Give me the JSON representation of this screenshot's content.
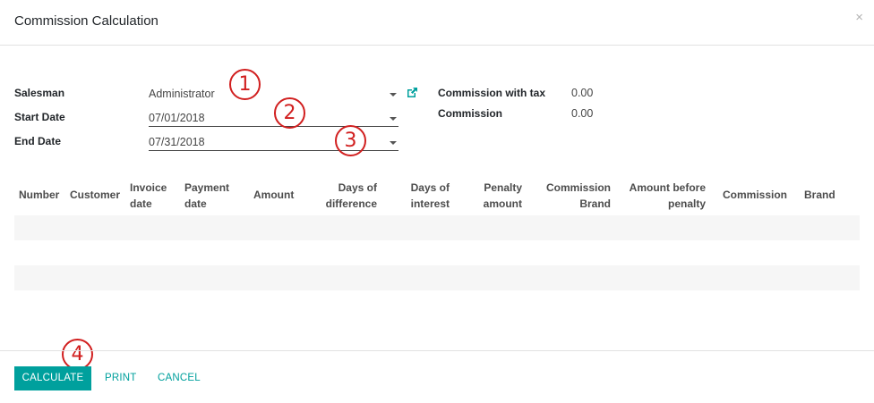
{
  "dialog": {
    "title": "Commission Calculation",
    "close_label": "×"
  },
  "form": {
    "salesman": {
      "label": "Salesman",
      "value": "Administrator"
    },
    "start_date": {
      "label": "Start Date",
      "value": "07/01/2018"
    },
    "end_date": {
      "label": "End Date",
      "value": "07/31/2018"
    }
  },
  "stats": {
    "commission_with_tax": {
      "label": "Commission with tax",
      "value": "0.00"
    },
    "commission": {
      "label": "Commission",
      "value": "0.00"
    }
  },
  "annotations": [
    "1",
    "2",
    "3",
    "4"
  ],
  "table": {
    "columns": [
      {
        "line1": "Number",
        "line2": ""
      },
      {
        "line1": "Customer",
        "line2": ""
      },
      {
        "line1": "Invoice",
        "line2": "date"
      },
      {
        "line1": "Payment",
        "line2": "date"
      },
      {
        "line1": "Amount",
        "line2": ""
      },
      {
        "line1": "Days of",
        "line2": "difference"
      },
      {
        "line1": "Days of",
        "line2": "interest"
      },
      {
        "line1": "Penalty",
        "line2": "amount"
      },
      {
        "line1": "Commission",
        "line2": "Brand"
      },
      {
        "line1": "Amount before",
        "line2": "penalty"
      },
      {
        "line1": "Commission",
        "line2": ""
      },
      {
        "line1": "Brand",
        "line2": ""
      }
    ]
  },
  "footer": {
    "calculate_label": "CALCULATE",
    "print_label": "PRINT",
    "cancel_label": "CANCEL"
  },
  "colors": {
    "accent": "#00a09d",
    "annotation": "#d11f1f"
  },
  "icons": {
    "external_link": "external-link-icon",
    "dropdown": "caret-down-icon",
    "close": "close-icon"
  }
}
